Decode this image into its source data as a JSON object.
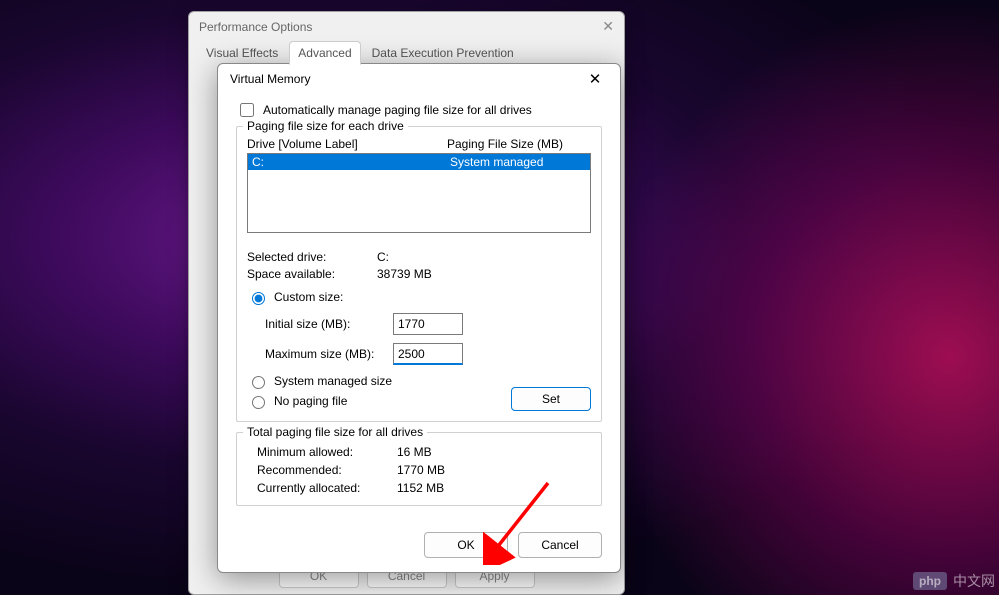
{
  "perf": {
    "title": "Performance Options",
    "tabs": {
      "visual": "Visual Effects",
      "advanced": "Advanced",
      "dep": "Data Execution Prevention"
    },
    "buttons": {
      "ok": "OK",
      "cancel": "Cancel",
      "apply": "Apply"
    }
  },
  "vm": {
    "title": "Virtual Memory",
    "auto_manage": "Automatically manage paging file size for all drives",
    "group_each": "Paging file size for each drive",
    "drive_header": {
      "col1": "Drive  [Volume Label]",
      "col2": "Paging File Size (MB)"
    },
    "drive_row": {
      "drive": "C:",
      "size": "System managed"
    },
    "selected_drive_lbl": "Selected drive:",
    "selected_drive_val": "C:",
    "space_lbl": "Space available:",
    "space_val": "38739 MB",
    "custom_size": "Custom size:",
    "initial_lbl": "Initial size (MB):",
    "initial_val": "1770",
    "max_lbl": "Maximum size (MB):",
    "max_val": "2500",
    "system_managed": "System managed size",
    "no_paging": "No paging file",
    "set_btn": "Set",
    "group_total": "Total paging file size for all drives",
    "min_lbl": "Minimum allowed:",
    "min_val": "16 MB",
    "rec_lbl": "Recommended:",
    "rec_val": "1770 MB",
    "cur_lbl": "Currently allocated:",
    "cur_val": "1152 MB",
    "ok": "OK",
    "cancel": "Cancel"
  },
  "watermark": {
    "php": "php",
    "text": "中文网"
  }
}
